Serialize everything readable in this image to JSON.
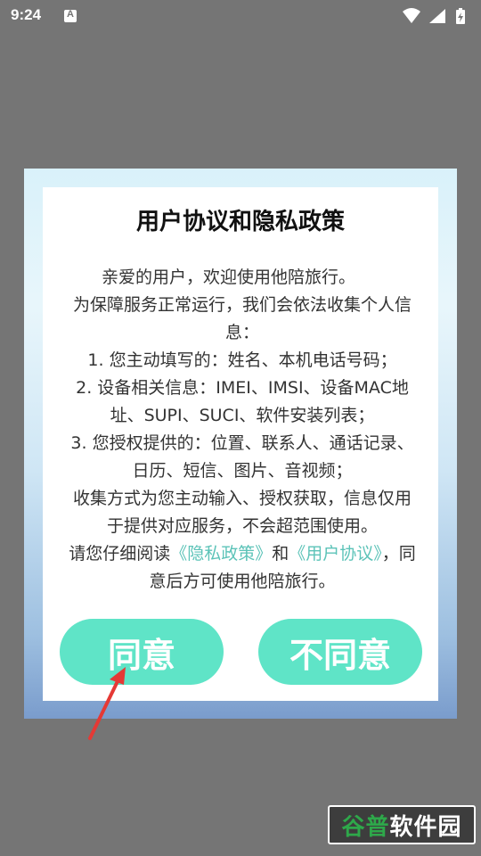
{
  "status_bar": {
    "time": "9:24",
    "notification_icon": "a-icon",
    "notification_letter": "A",
    "icons": [
      "wifi-icon",
      "cell-signal-icon",
      "battery-icon"
    ]
  },
  "dialog": {
    "title": "用户协议和隐私政策",
    "greeting": "亲爱的用户，欢迎使用他陪旅行。",
    "intro": "为保障服务正常运行，我们会依法收集个人信息：",
    "item1": "1. 您主动填写的：姓名、本机电话号码；",
    "item2": "2. 设备相关信息：IMEI、IMSI、设备MAC地址、SUPI、SUCI、软件安装列表；",
    "item3": "3. 您授权提供的：位置、联系人、通话记录、日历、短信、图片、音视频；",
    "collection": "收集方式为您主动输入、授权获取，信息仅用于提供对应服务，不会超范围使用。",
    "read_prefix": "请您仔细阅读",
    "privacy_link": "《隐私政策》",
    "and": "和",
    "agreement_link": "《用户协议》",
    "read_suffix": "，同意后方可使用他陪旅行。",
    "agree_label": "同意",
    "disagree_label": "不同意"
  },
  "watermark": {
    "part1": "谷普",
    "part2": "软件园"
  },
  "colors": {
    "overlay": "#757575",
    "button": "#5fe4c7",
    "link": "#5cc3b8",
    "arrow": "#e53935"
  }
}
